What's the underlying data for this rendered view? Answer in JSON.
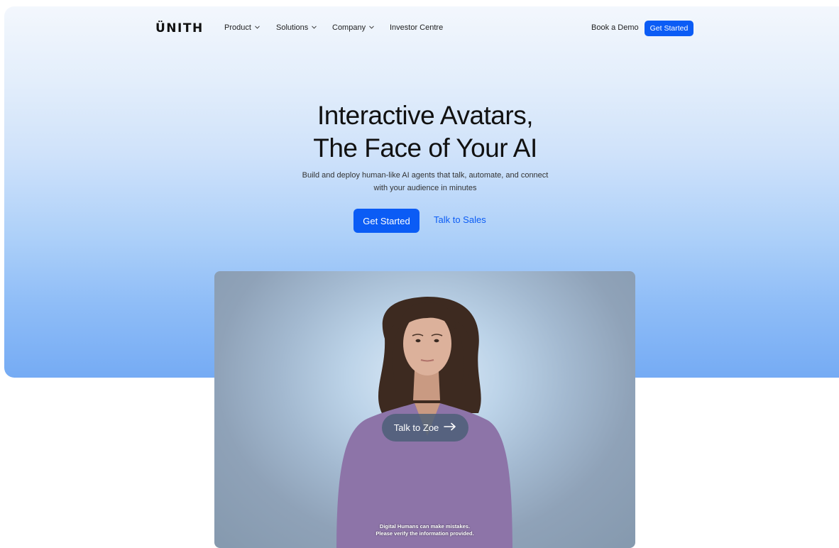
{
  "nav": {
    "logo": "ÜNITH",
    "items": [
      {
        "label": "Product",
        "has_dropdown": true
      },
      {
        "label": "Solutions",
        "has_dropdown": true
      },
      {
        "label": "Company",
        "has_dropdown": true
      },
      {
        "label": "Investor Centre",
        "has_dropdown": false
      }
    ],
    "book_demo": "Book a Demo",
    "get_started": "Get Started"
  },
  "hero": {
    "title_line1": "Interactive Avatars,",
    "title_line2": "The Face of Your AI",
    "subtitle_line1": "Build and deploy human-like AI agents that talk, automate, and connect",
    "subtitle_line2": "with your audience in minutes",
    "primary_cta": "Get Started",
    "secondary_cta": "Talk to Sales"
  },
  "avatar_demo": {
    "talk_button": "Talk to Zoe",
    "talk_icon": "arrow-right-icon",
    "disclaimer_line1": "Digital Humans can make mistakes.",
    "disclaimer_line2": "Please verify the information provided."
  },
  "colors": {
    "accent": "#0b5cf5",
    "hero_top": "#f3f7fd",
    "hero_bottom": "#75abf4",
    "sweater": "#8d74a8",
    "hair": "#3d2a20"
  }
}
